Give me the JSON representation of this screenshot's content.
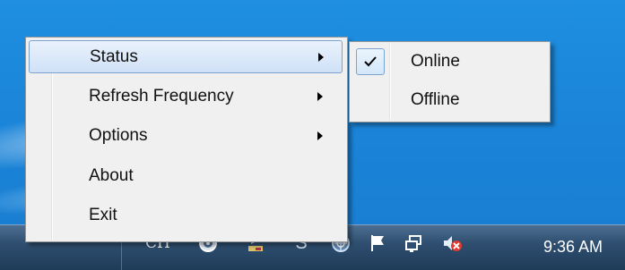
{
  "context_menu": {
    "items": [
      {
        "label": "Status",
        "has_submenu": true,
        "highlighted": true
      },
      {
        "label": "Refresh Frequency",
        "has_submenu": true,
        "highlighted": false
      },
      {
        "label": "Options",
        "has_submenu": true,
        "highlighted": false
      },
      {
        "label": "About",
        "has_submenu": false,
        "highlighted": false
      },
      {
        "label": "Exit",
        "has_submenu": false,
        "highlighted": false
      }
    ]
  },
  "status_submenu": {
    "items": [
      {
        "label": "Online",
        "checked": true
      },
      {
        "label": "Offline",
        "checked": false
      }
    ]
  },
  "taskbar": {
    "language": "CH",
    "clock": "9:36 AM",
    "tray_icons": [
      "input-method-icon",
      "app-icon",
      "skype-icon",
      "network-globe-icon",
      "action-center-flag-icon",
      "network-monitor-icon",
      "volume-muted-icon"
    ]
  },
  "colors": {
    "desktop": "#1b86da",
    "taskbar": "#2f4f70",
    "menu_bg": "#f0f0f0",
    "highlight_border": "#7da2ce",
    "muted_badge": "#e03a2f"
  }
}
